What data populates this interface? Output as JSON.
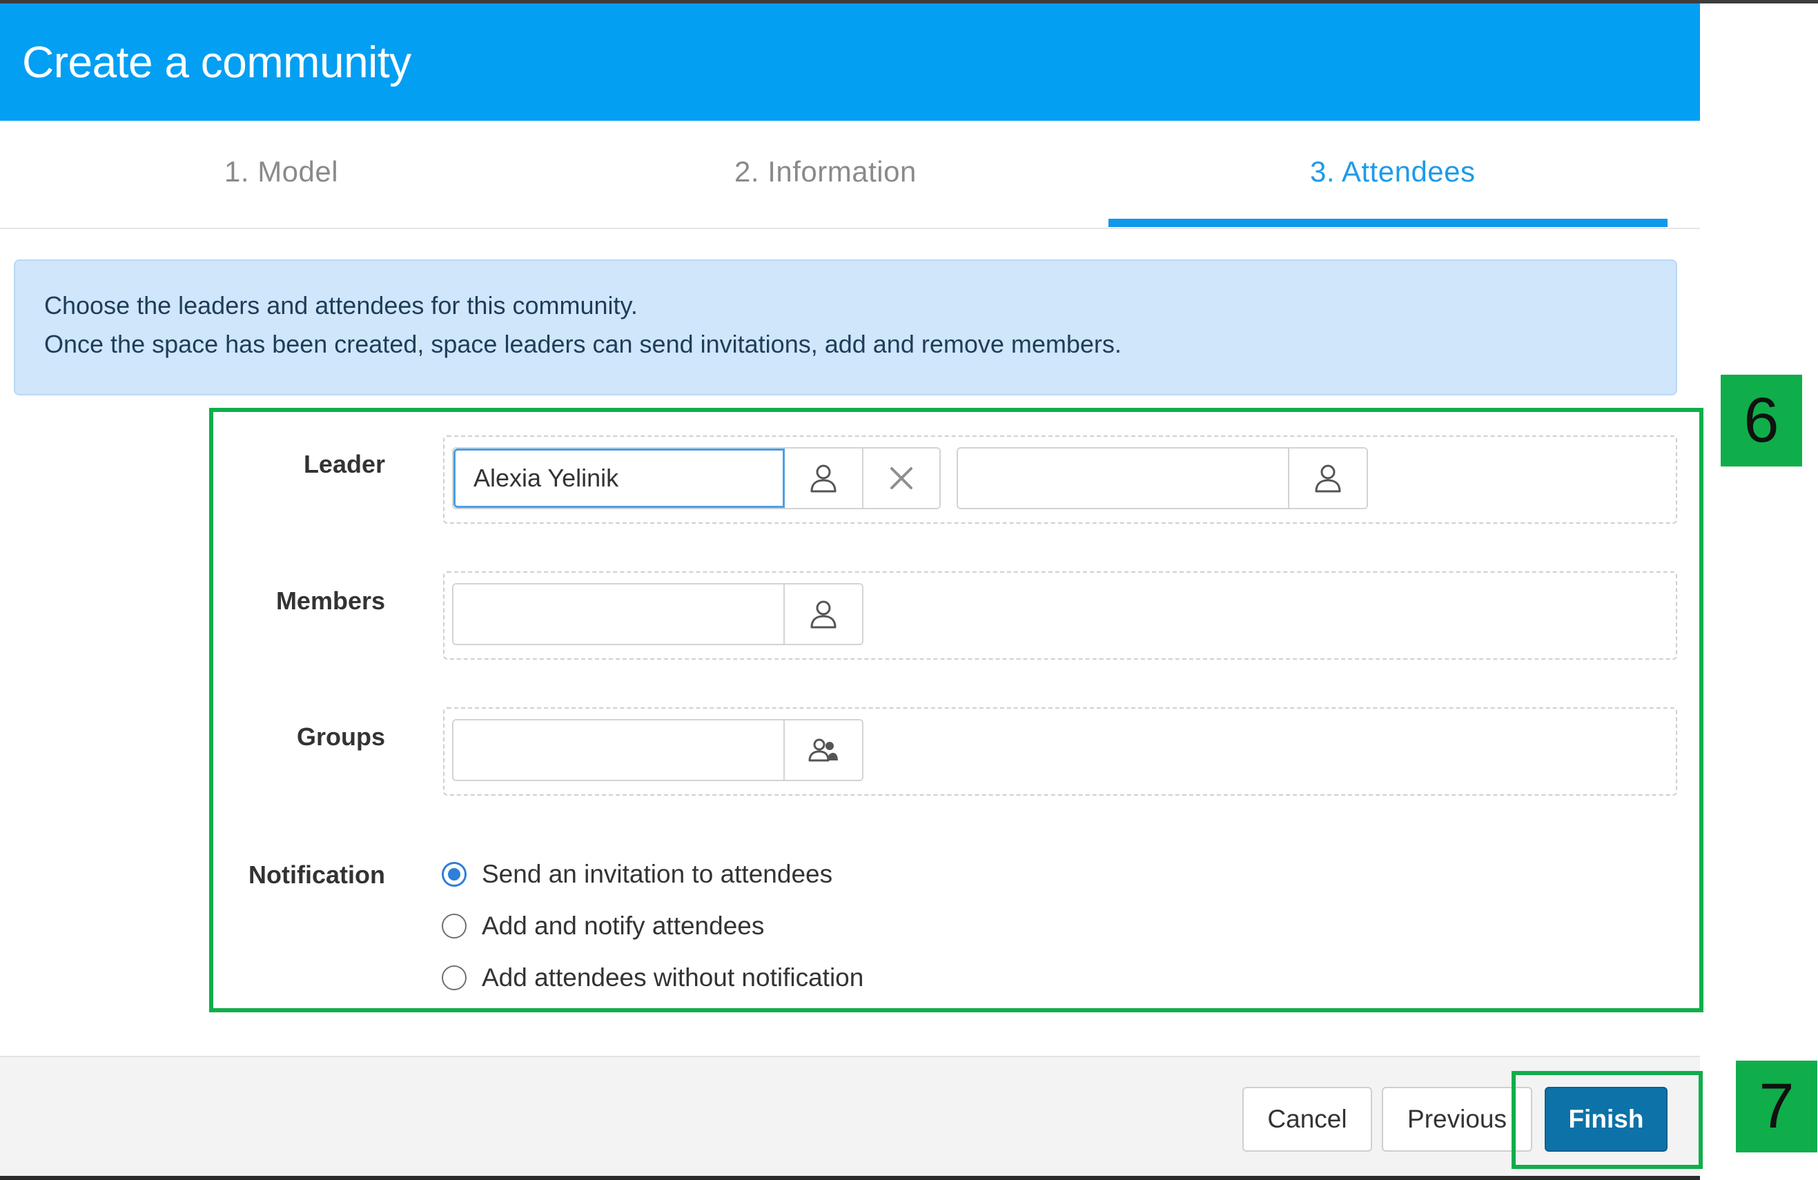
{
  "dialog": {
    "title": "Create a community"
  },
  "tabs": [
    {
      "label": "1. Model",
      "active": false
    },
    {
      "label": "2. Information",
      "active": false
    },
    {
      "label": "3. Attendees",
      "active": true
    }
  ],
  "info": {
    "line1": "Choose the leaders and attendees for this community.",
    "line2": "Once the space has been created, space leaders can send invitations, add and remove members."
  },
  "form": {
    "leader": {
      "label": "Leader",
      "value": "Alexia Yelinik",
      "second_value": ""
    },
    "members": {
      "label": "Members",
      "value": ""
    },
    "groups": {
      "label": "Groups",
      "value": ""
    },
    "notification": {
      "label": "Notification",
      "options": [
        {
          "label": "Send an invitation to attendees",
          "checked": true
        },
        {
          "label": "Add and notify attendees",
          "checked": false
        },
        {
          "label": "Add attendees without notification",
          "checked": false
        }
      ]
    }
  },
  "footer": {
    "cancel_label": "Cancel",
    "previous_label": "Previous",
    "finish_label": "Finish"
  },
  "callouts": {
    "step6": "6",
    "step7": "7"
  },
  "colors": {
    "header": "#039ff3",
    "active_tab": "#1e9be9",
    "finish_button": "#0d72a8",
    "callout": "#0fae4a",
    "info_bg": "#cfe6fb"
  },
  "icons": [
    "user-icon",
    "close-icon",
    "group-icon"
  ]
}
